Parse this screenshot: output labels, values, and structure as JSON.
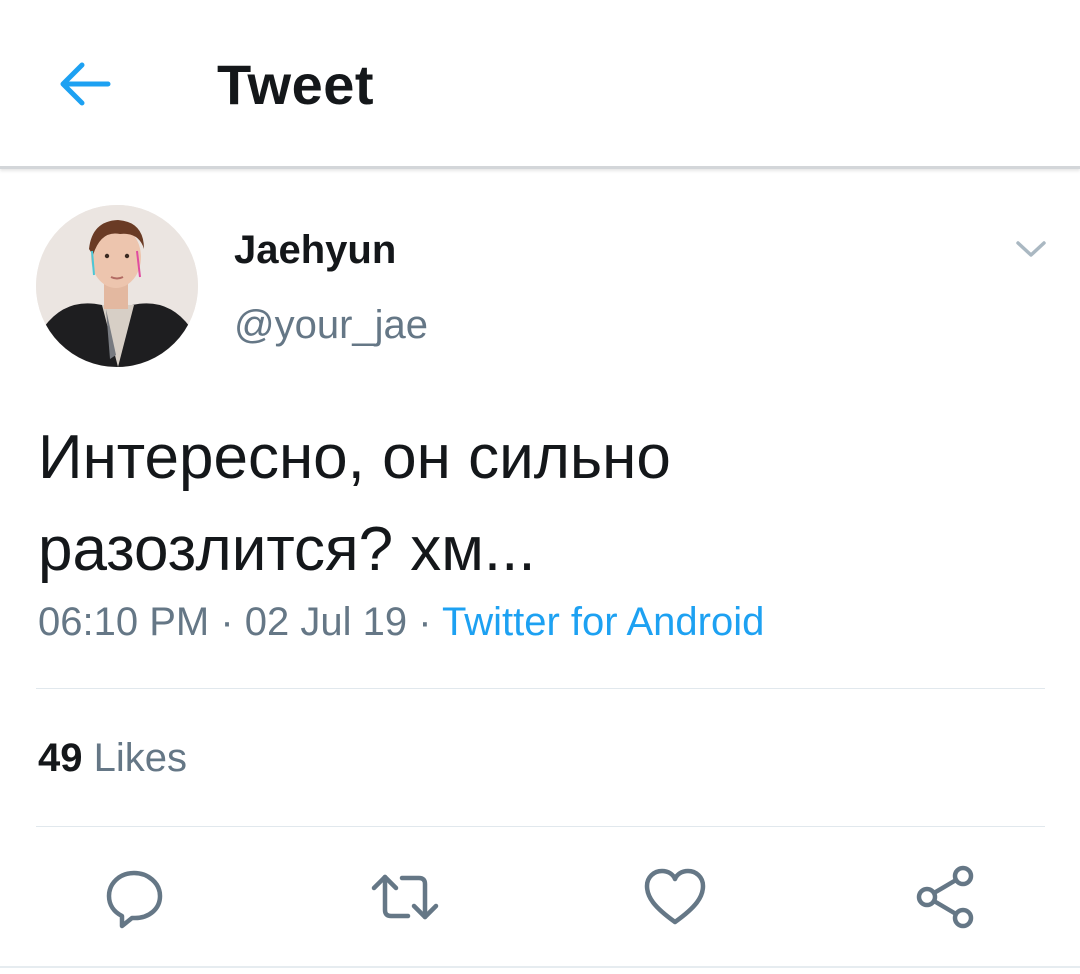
{
  "header": {
    "title": "Tweet",
    "back_icon": "arrow-left-icon",
    "accent_color": "#1da1f2"
  },
  "tweet": {
    "author": {
      "display_name": "Jaehyun",
      "handle": "@your_jae",
      "avatar": "profile-photo"
    },
    "menu_icon": "chevron-down-icon",
    "text_lines": [
      "Интересно, он сильно",
      "разозлится? хм..."
    ],
    "time": "06:10 PM",
    "separator": "·",
    "date": "02 Jul 19",
    "source": "Twitter for Android",
    "source_color": "#1da1f2",
    "likes": {
      "count": "49",
      "label": "Likes"
    }
  },
  "actions": [
    {
      "name": "reply",
      "icon": "reply-icon"
    },
    {
      "name": "retweet",
      "icon": "retweet-icon"
    },
    {
      "name": "like",
      "icon": "heart-icon"
    },
    {
      "name": "share",
      "icon": "share-icon"
    }
  ],
  "colors": {
    "text": "#14171a",
    "secondary": "#657786",
    "icon": "#657786",
    "divider": "#e1e8ed"
  }
}
